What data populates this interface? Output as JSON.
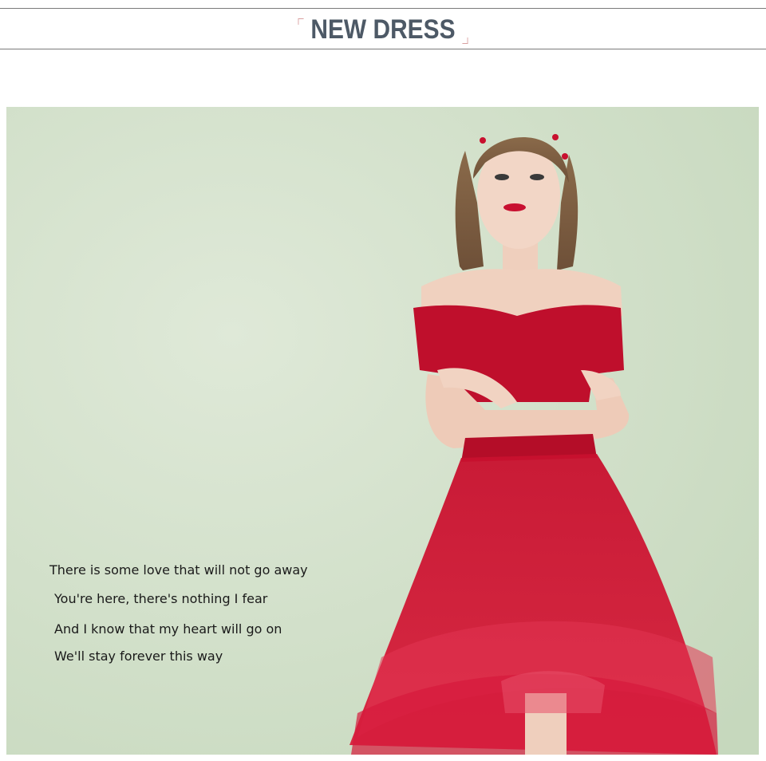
{
  "header": {
    "title": "NEW DRESS"
  },
  "photo": {
    "subject": "model-in-red-off-shoulder-tulle-dress",
    "background_color": "#cfe0c8",
    "dress_color": "#c8102e"
  },
  "caption": {
    "lines": [
      "There is some love that will not go away",
      "You're here, there's nothing I fear",
      "And I know that my heart will go on",
      "We'll stay forever this way"
    ]
  }
}
